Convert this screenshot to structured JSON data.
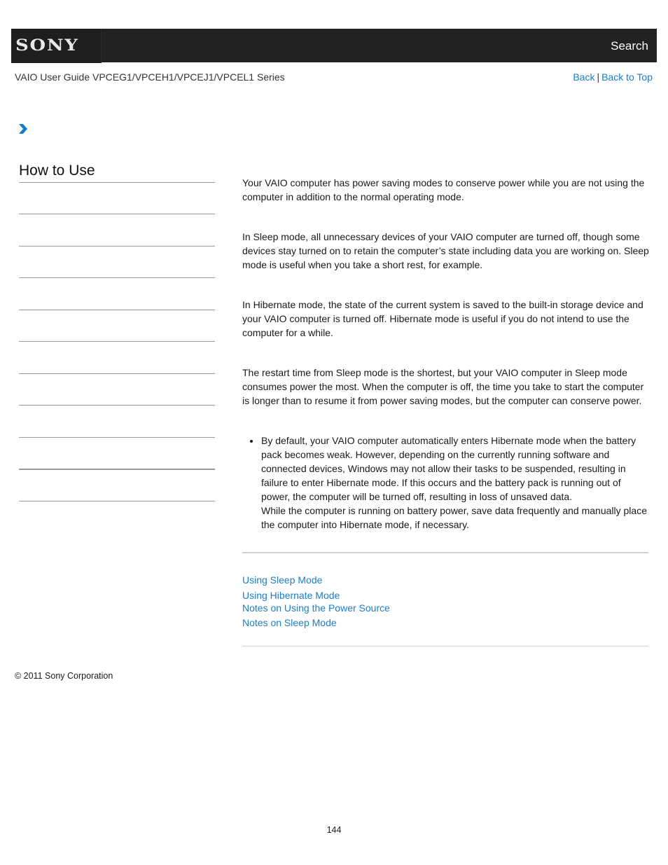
{
  "header": {
    "logo_text": "SONY",
    "search_label": "Search"
  },
  "guide_title": "VAIO User Guide VPCEG1/VPCEH1/VPCEJ1/VPCEL1 Series",
  "top_nav": {
    "back_label": "Back",
    "separator": "|",
    "back_to_top_label": "Back to Top"
  },
  "breadcrumb_icon": "chevron-right-icon",
  "sidebar": {
    "title": "How to Use",
    "items": [
      "",
      "",
      "",
      "",
      "",
      "",
      "",
      "",
      "",
      ""
    ]
  },
  "main": {
    "paragraphs": [
      "Your VAIO computer has power saving modes to conserve power while you are not using the computer in addition to the normal operating mode.",
      "In Sleep mode, all unnecessary devices of your VAIO computer are turned off, though some devices stay turned on to retain the computer’s state including data you are working on. Sleep mode is useful when you take a short rest, for example.",
      "In Hibernate mode, the state of the current system is saved to the built-in storage device and your VAIO computer is turned off. Hibernate mode is useful if you do not intend to use the computer for a while.",
      "The restart time from Sleep mode is the shortest, but your VAIO computer in Sleep mode consumes power the most. When the computer is off, the time you take to start the computer is longer than to resume it from power saving modes, but the computer can conserve power."
    ],
    "note_bullets": [
      {
        "line1": "By default, your VAIO computer automatically enters Hibernate mode when the battery pack becomes weak. However, depending on the currently running software and connected devices, Windows may not allow their tasks to be suspended, resulting in failure to enter Hibernate mode. If this occurs and the battery pack is running out of power, the computer will be turned off, resulting in loss of unsaved data.",
        "line2": "While the computer is running on battery power, save data frequently and manually place the computer into Hibernate mode, if necessary."
      }
    ],
    "related_links": [
      "Using Sleep Mode",
      "Using Hibernate Mode",
      "Notes on Using the Power Source",
      "Notes on Sleep Mode"
    ]
  },
  "footer": {
    "copyright": "© 2011 Sony Corporation",
    "page_number": "144"
  },
  "colors": {
    "header_bg": "#222222",
    "link": "#1a7ccc",
    "chevron": "#1a7ccc"
  }
}
